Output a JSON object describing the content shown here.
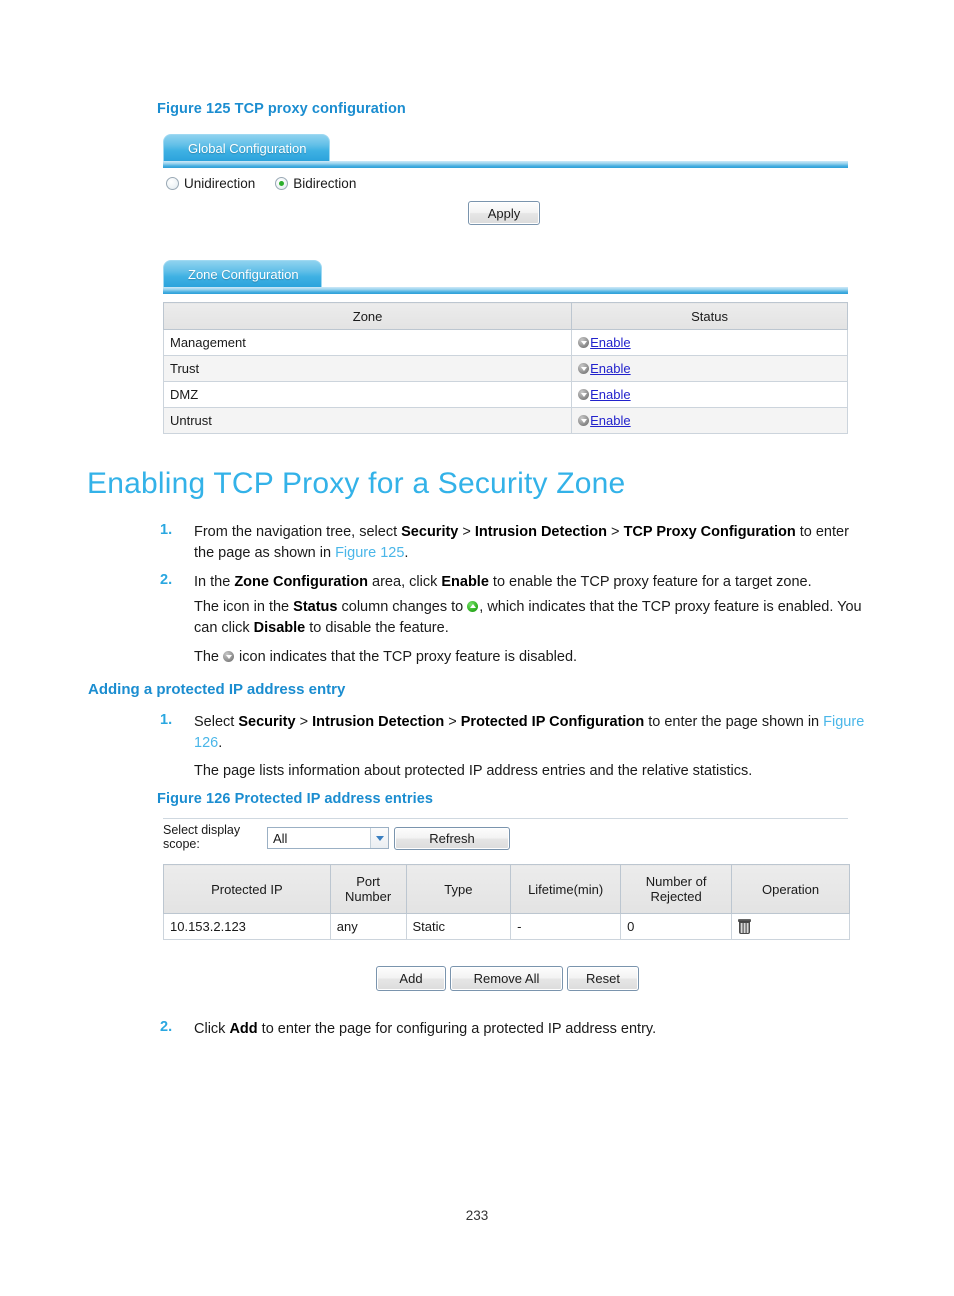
{
  "page": {
    "number": "233"
  },
  "figure125": {
    "caption": "Figure 125 TCP proxy configuration",
    "global_tab": "Global Configuration",
    "radio_unidirection": "Unidirection",
    "radio_bidirection": "Bidirection",
    "selected_direction": "Bidirection",
    "apply_button": "Apply",
    "zone_tab": "Zone Configuration",
    "zone_table": {
      "headers": [
        "Zone",
        "Status"
      ],
      "rows": [
        {
          "zone": "Management",
          "status": "Enable",
          "icon": "circle-down-icon"
        },
        {
          "zone": "Trust",
          "status": "Enable",
          "icon": "circle-down-icon"
        },
        {
          "zone": "DMZ",
          "status": "Enable",
          "icon": "circle-down-icon"
        },
        {
          "zone": "Untrust",
          "status": "Enable",
          "icon": "circle-down-icon"
        }
      ]
    }
  },
  "heading": {
    "h1": "Enabling TCP Proxy for a Security Zone",
    "h2": "Adding a protected IP address entry"
  },
  "steps_tcp": {
    "num1": "1.",
    "s1_a": "From the navigation tree, select ",
    "s1_b1": "Security",
    "s1_sep1": " > ",
    "s1_b2": "Intrusion Detection",
    "s1_sep2": " > ",
    "s1_b3": "TCP Proxy Configuration",
    "s1_c": " to enter the page as shown in ",
    "s1_xref": "Figure 125",
    "s1_d": ".",
    "num2": "2.",
    "s2_a": "In the ",
    "s2_b1": "Zone Configuration",
    "s2_b": " area, click ",
    "s2_b2": "Enable",
    "s2_c": " to enable the TCP proxy feature for a target zone.",
    "s2_p1_a": "The icon in the ",
    "s2_p1_b": "Status",
    "s2_p1_c": " column changes to ",
    "s2_p1_d": ", which indicates that the TCP proxy feature is enabled. You can click ",
    "s2_p1_e": "Disable",
    "s2_p1_f": " to disable the feature.",
    "s2_p2_a": "The ",
    "s2_p2_b": " icon indicates that the TCP proxy feature is disabled."
  },
  "steps_protected": {
    "num1": "1.",
    "s1_a": "Select ",
    "s1_b1": "Security",
    "s1_sep1": " > ",
    "s1_b2": "Intrusion Detection",
    "s1_sep2": " > ",
    "s1_b3": "Protected IP Configuration",
    "s1_c": " to enter the page shown in ",
    "s1_xref1": "Figure",
    "s1_xref2": "126",
    "s1_d": ".",
    "s1_p": "The page lists information about protected IP address entries and the relative statistics.",
    "num2": "2.",
    "s2_a": "Click ",
    "s2_b": "Add",
    "s2_c": " to enter the page for configuring a protected IP address entry."
  },
  "figure126": {
    "caption": "Figure 126 Protected IP address entries",
    "scope_label_line1": "Select display",
    "scope_label_line2": "scope:",
    "scope_value": "All",
    "refresh_button": "Refresh",
    "table": {
      "headers": [
        "Protected IP",
        "Port Number",
        "Type",
        "Lifetime(min)",
        "Number of Rejected",
        "Operation"
      ],
      "headers_wrapped": [
        [
          "Protected IP"
        ],
        [
          "Port",
          "Number"
        ],
        [
          "Type"
        ],
        [
          "Lifetime(min)"
        ],
        [
          "Number of",
          "Rejected"
        ],
        [
          "Operation"
        ]
      ],
      "rows": [
        {
          "protected_ip": "10.153.2.123",
          "port_number": "any",
          "type": "Static",
          "lifetime": "-",
          "rejected": "0",
          "operation_icon": "trash-icon"
        }
      ]
    },
    "buttons": [
      "Add",
      "Remove All",
      "Reset"
    ]
  },
  "colors": {
    "heading_blue": "#33b2e8",
    "caption_blue": "#1b8dd0",
    "xref_blue": "#4ab6e8",
    "link_blue": "#2222cc",
    "tab_blue": "#3fb1e3",
    "enabled_green": "#33b325"
  }
}
